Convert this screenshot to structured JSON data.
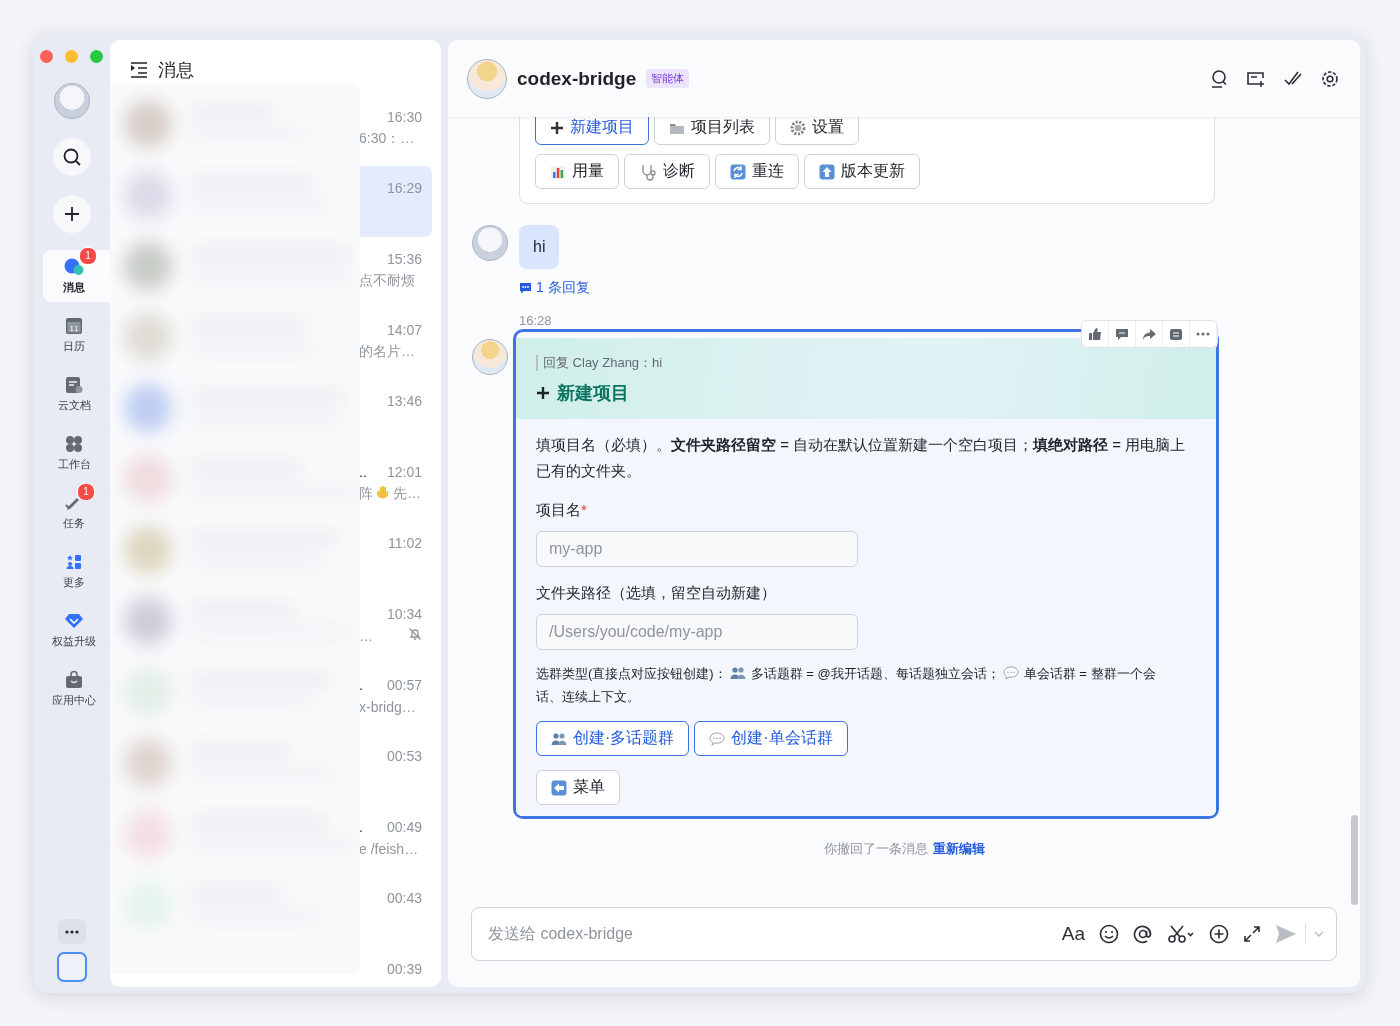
{
  "window": {
    "controls": [
      {
        "color": "#ff5f57"
      },
      {
        "color": "#febc2e"
      },
      {
        "color": "#28c840"
      }
    ]
  },
  "sidebar": {
    "items": [
      {
        "label": "消息",
        "selected": true,
        "badge": "1"
      },
      {
        "label": "日历",
        "selected": false,
        "icon_text": "11"
      },
      {
        "label": "云文档",
        "selected": false
      },
      {
        "label": "工作台",
        "selected": false
      },
      {
        "label": "任务",
        "selected": false,
        "badge": "1"
      },
      {
        "label": "更多",
        "selected": false
      },
      {
        "label": "权益升级",
        "selected": false
      },
      {
        "label": "应用中心",
        "selected": false
      }
    ]
  },
  "conversation_list": {
    "title": "消息",
    "rows": [
      {
        "time": "16:30",
        "preview": "6:30：…",
        "selected": false,
        "muted": false
      },
      {
        "time": "16:29",
        "selected": true,
        "muted": false
      },
      {
        "time": "15:36",
        "preview": "点不耐烦",
        "selected": false,
        "muted": false
      },
      {
        "time": "14:07",
        "preview": "的名片…",
        "selected": false,
        "muted": false
      },
      {
        "time": "13:46",
        "selected": false,
        "muted": false
      },
      {
        "time": "12:01",
        "name_tail": "..",
        "preview": "阵",
        "preview_end": "先…",
        "selected": false,
        "muted": false
      },
      {
        "time": "11:02",
        "selected": false,
        "muted": false
      },
      {
        "time": "10:34",
        "preview": "…",
        "selected": false,
        "muted": true
      },
      {
        "time": "00:57",
        "name_tail": ".",
        "preview": "x-bridg…",
        "selected": false,
        "muted": false
      },
      {
        "time": "00:53",
        "selected": false,
        "muted": false
      },
      {
        "time": "00:49",
        "name_tail": ".",
        "preview": "e /feish…",
        "selected": false,
        "muted": false
      },
      {
        "time": "00:43",
        "selected": false,
        "muted": false
      },
      {
        "time": "00:39",
        "selected": false,
        "muted": false
      }
    ]
  },
  "chat": {
    "title": "codex-bridge",
    "tag": "智能体",
    "messages": [
      {
        "kind": "menu_card",
        "button_rows": [
          [
            {
              "label": "新建项目",
              "primary": true
            },
            {
              "label": "项目列表",
              "primary": false
            },
            {
              "label": "设置",
              "primary": false
            }
          ],
          [
            {
              "label": "用量",
              "primary": false
            },
            {
              "label": "诊断",
              "primary": false
            },
            {
              "label": "重连",
              "primary": false
            },
            {
              "label": "版本更新",
              "primary": false
            }
          ]
        ]
      },
      {
        "kind": "text",
        "text": "hi",
        "reply_link": "1 条回复"
      },
      {
        "kind": "form_card",
        "time": "16:28",
        "highlighted": true,
        "quote": "回复 Clay Zhang：hi",
        "title": "新建项目",
        "description": "填项目名（必填）。**文件夹路径留空** = 自动在默认位置新建一个空白项目；**填绝对路径** = 用电脑上已有的文件夹。",
        "fields": [
          {
            "label": "项目名",
            "required_mark": "*",
            "placeholder": "my-app"
          },
          {
            "label": "文件夹路径（选填，留空自动新建）",
            "placeholder": "/Users/you/code/my-app"
          }
        ],
        "note": [
          "选群类型(直接点对应按钮创建)：",
          "多话题群 = @我开话题、每话题独立会话；",
          "单会话群 = 整群一个会",
          "话、连续上下文。"
        ],
        "button_rows": [
          [
            {
              "label": "创建·多话题群",
              "primary": true
            },
            {
              "label": "创建·单会话群",
              "primary": true
            }
          ],
          [
            {
              "label": "菜单",
              "primary": false
            }
          ]
        ]
      },
      {
        "kind": "recall",
        "text": "你撤回了一条消息",
        "action": "重新编辑"
      }
    ]
  },
  "composer": {
    "placeholder": "发送给 codex-bridge",
    "format_label": "Aa"
  }
}
